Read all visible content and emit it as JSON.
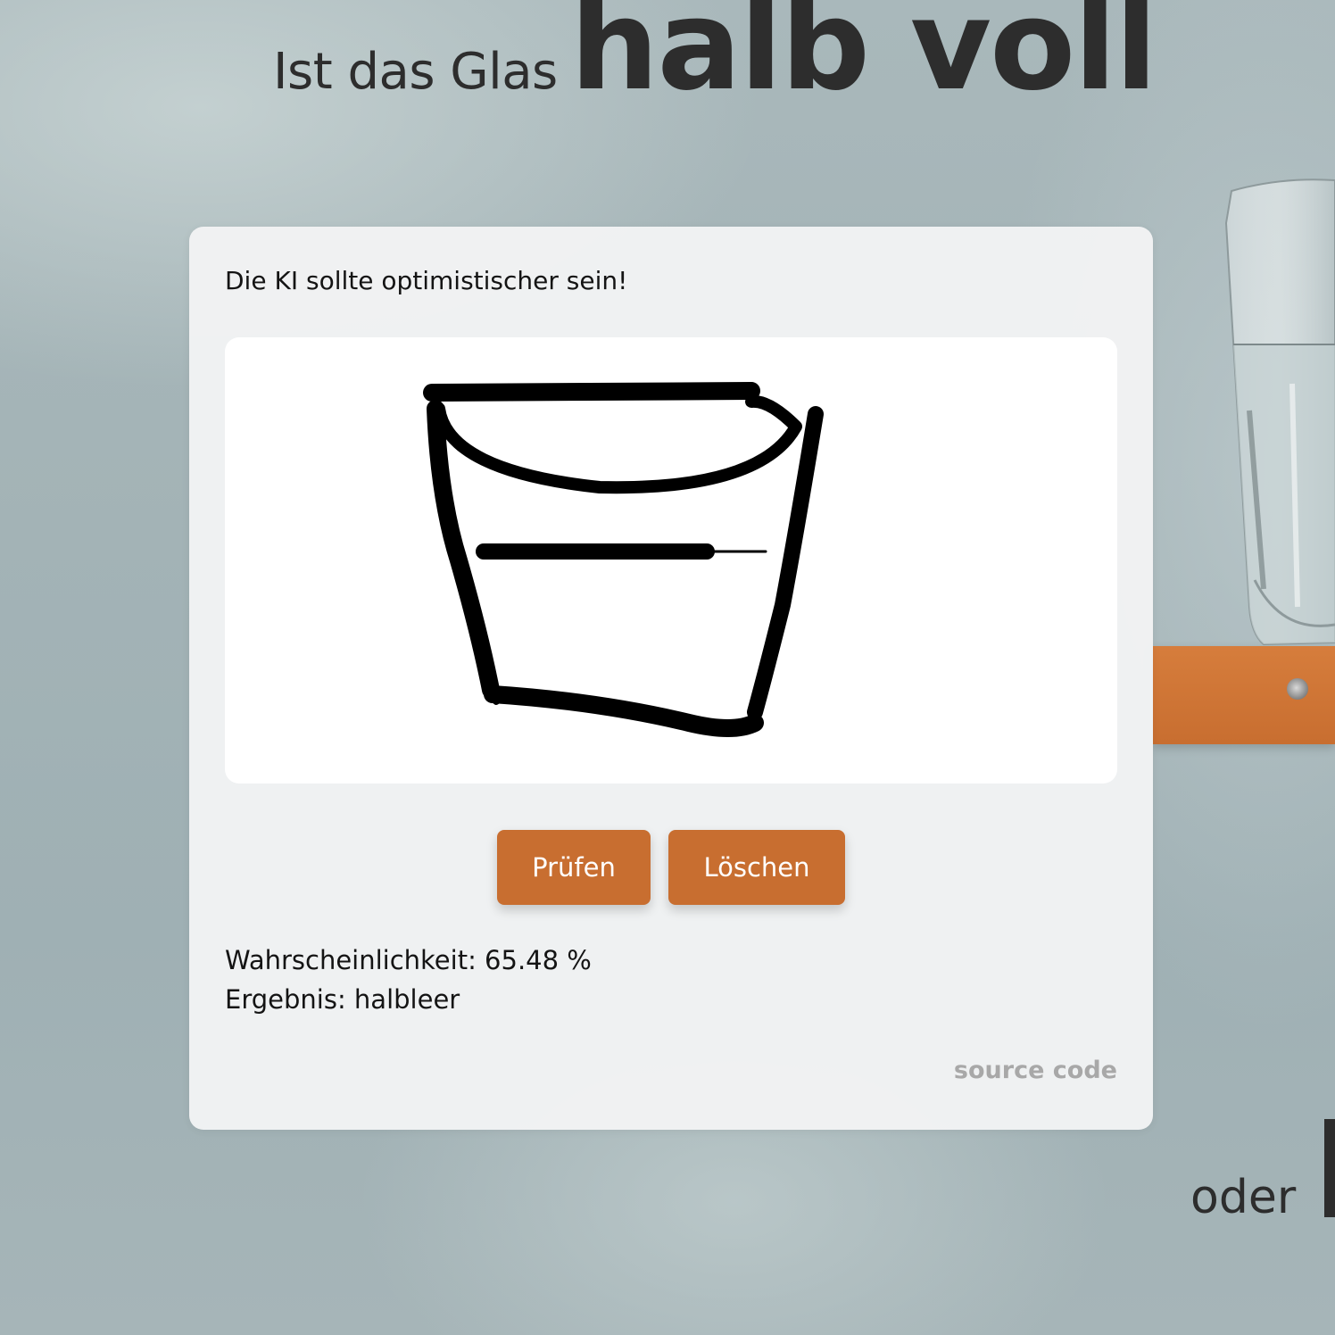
{
  "header": {
    "prefix": "Ist das Glas",
    "emphasis": "halb voll"
  },
  "panel": {
    "hint": "Die KI sollte optimistischer sein!",
    "buttons": {
      "check_label": "Prüfen",
      "clear_label": "Löschen"
    },
    "result": {
      "probability_line": "Wahrscheinlichkeit: 65.48 %",
      "outcome_line": "Ergebnis: halbleer"
    },
    "source_link": "source code"
  },
  "footer": {
    "oder": "oder"
  },
  "colors": {
    "accent": "#c86e30",
    "text_dark": "#2d2d2d",
    "muted_link": "#a8a8a8"
  }
}
